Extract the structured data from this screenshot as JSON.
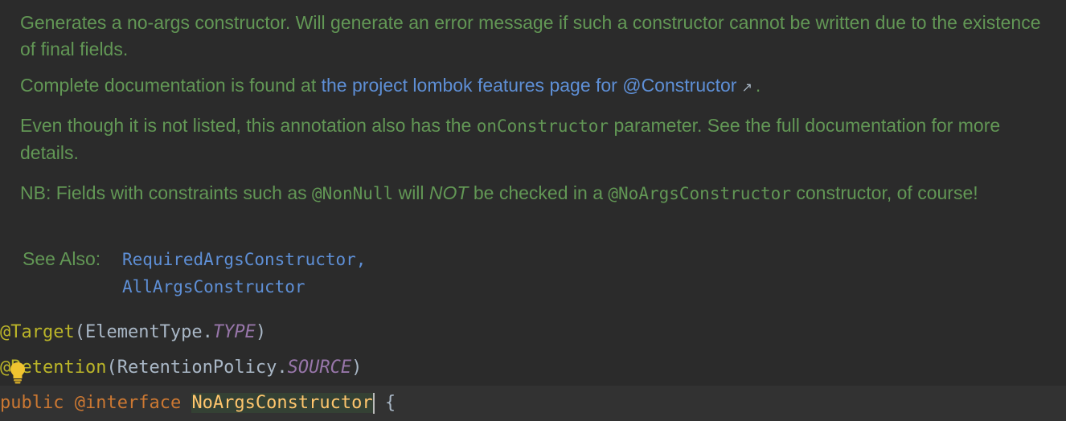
{
  "doc": {
    "p1": "Generates a no-args constructor. Will generate an error message if such a constructor cannot be written due to the existence of final fields.",
    "p2_prefix": "Complete documentation is found at ",
    "p2_link": "the project lombok features page for @Constructor",
    "p2_suffix": ".",
    "p3_a": "Even though it is not listed, this annotation also has the ",
    "p3_code": "onConstructor",
    "p3_b": " parameter. See the full documentation for more details.",
    "p4_a": "NB: Fields with constraints such as ",
    "p4_code1": "@NonNull",
    "p4_b": " will ",
    "p4_em": "NOT",
    "p4_c": " be checked in a ",
    "p4_code2": "@NoArgsConstructor",
    "p4_d": " constructor, of course!",
    "see_also_label": "See Also:",
    "see_also": [
      "RequiredArgsConstructor,",
      "AllArgsConstructor"
    ]
  },
  "code": {
    "line1": {
      "anno": "@Target",
      "open": "(",
      "type": "ElementType.",
      "const": "TYPE",
      "close": ")"
    },
    "line2": {
      "anno": "@Retention",
      "open": "(",
      "type": "RetentionPolicy.",
      "const": "SOURCE",
      "close": ")"
    },
    "line3": {
      "kw1": "public",
      "kw2": "@interface",
      "name": "NoArgsConstructor",
      "brace": "{"
    }
  },
  "colors": {
    "background": "#2b2b2b",
    "doc_text": "#629755",
    "link": "#5e8fd6",
    "annotation": "#bbb529",
    "keyword": "#cc7832",
    "constant": "#9876aa",
    "declaration": "#ffc66d",
    "lightbulb": "#f0c330"
  },
  "icons": {
    "external_link": "arrow-up-right-icon",
    "intention": "lightbulb-icon"
  }
}
